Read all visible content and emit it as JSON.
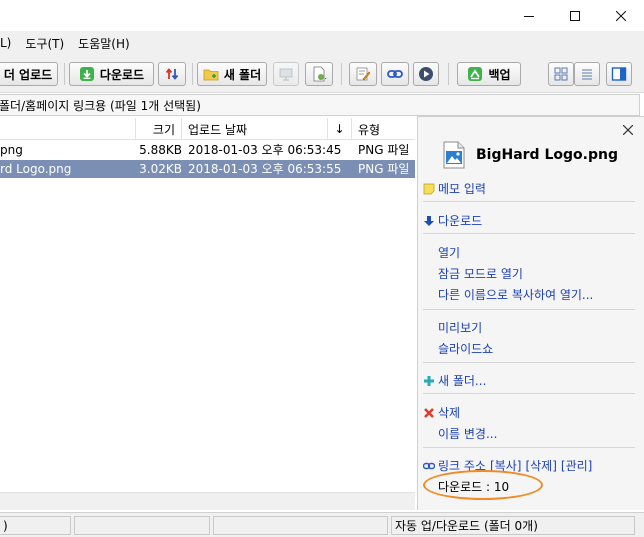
{
  "menu": {
    "items": [
      "L)",
      "도구(T)",
      "도움말(H)"
    ]
  },
  "toolbar": {
    "upload_label": "더 업로드",
    "download_label": "다운로드",
    "new_folder_label": "새 폴더",
    "backup_label": "백업"
  },
  "path": {
    "text": "폴더/홈페이지 링크용 (파일 1개 선택됨)"
  },
  "filelist": {
    "columns": {
      "size": "크기",
      "date": "업로드 날짜",
      "sort_arrow": "↓",
      "type": "유형"
    },
    "rows": [
      {
        "name": "png",
        "size": "5.88KB",
        "date": "2018-01-03 오후 06:53:45",
        "type": "PNG 파일"
      },
      {
        "name": "rd Logo.png",
        "size": "3.02KB",
        "date": "2018-01-03 오후 06:53:55",
        "type": "PNG 파일"
      }
    ]
  },
  "sidepanel": {
    "close": "✕",
    "filename": "BigHard Logo.png",
    "memo": "메모 입력",
    "download": "다운로드",
    "open": "열기",
    "open_locked": "잠금 모드로 열기",
    "save_as": "다른 이름으로 복사하여 열기...",
    "preview": "미리보기",
    "slideshow": "슬라이드쇼",
    "new_folder": "새 폴더...",
    "delete": "삭제",
    "rename": "이름 변경...",
    "link_address": "링크 주소",
    "link_copy": "[복사]",
    "link_delete": "[삭제]",
    "link_manage": "[관리]",
    "download_count": "다운로드 : 10"
  },
  "status": {
    "left": ")",
    "right": "자동 업/다운로드 (폴더 0개)"
  },
  "colors": {
    "selection": "#7b8fb5",
    "link": "#1a3fb8",
    "highlight": "#f08a24"
  }
}
